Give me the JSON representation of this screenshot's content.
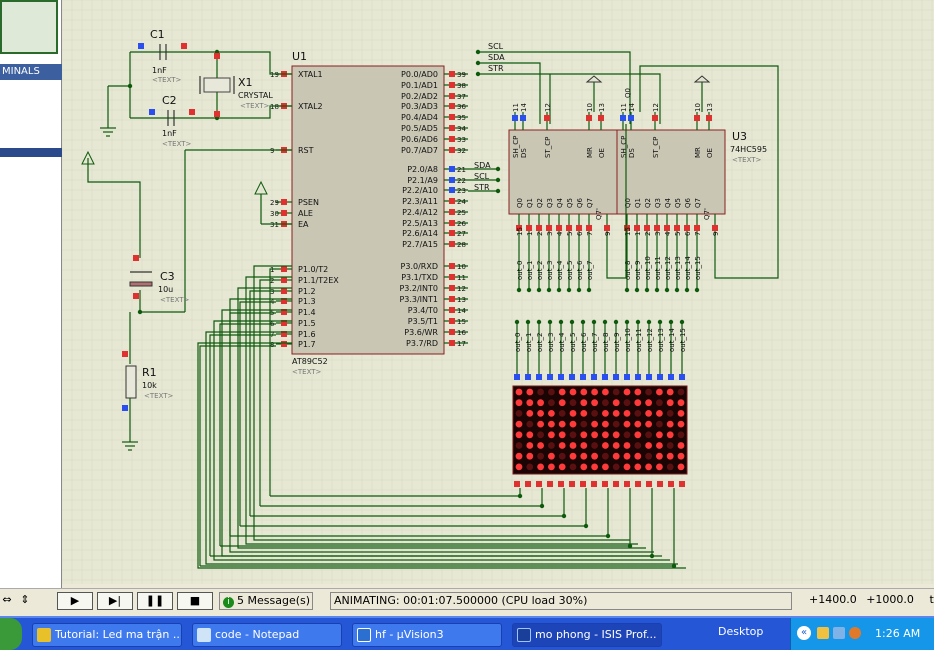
{
  "left_panel": {
    "terminals_label": "MINALS"
  },
  "schematic": {
    "u1": {
      "ref": "U1",
      "part": "AT89C52",
      "text": "<TEXT>",
      "left_pins": [
        {
          "num": "19",
          "name": "XTAL1"
        },
        {
          "num": "18",
          "name": "XTAL2"
        },
        {
          "num": "9",
          "name": "RST"
        },
        {
          "num": "29",
          "name": "PSEN"
        },
        {
          "num": "30",
          "name": "ALE"
        },
        {
          "num": "31",
          "name": "EA"
        },
        {
          "num": "1",
          "name": "P1.0/T2"
        },
        {
          "num": "2",
          "name": "P1.1/T2EX"
        },
        {
          "num": "3",
          "name": "P1.2"
        },
        {
          "num": "4",
          "name": "P1.3"
        },
        {
          "num": "5",
          "name": "P1.4"
        },
        {
          "num": "6",
          "name": "P1.5"
        },
        {
          "num": "7",
          "name": "P1.6"
        },
        {
          "num": "8",
          "name": "P1.7"
        }
      ],
      "right_pins": [
        {
          "num": "39",
          "name": "P0.0/AD0"
        },
        {
          "num": "38",
          "name": "P0.1/AD1"
        },
        {
          "num": "37",
          "name": "P0.2/AD2"
        },
        {
          "num": "36",
          "name": "P0.3/AD3"
        },
        {
          "num": "35",
          "name": "P0.4/AD4"
        },
        {
          "num": "34",
          "name": "P0.5/AD5"
        },
        {
          "num": "33",
          "name": "P0.6/AD6"
        },
        {
          "num": "32",
          "name": "P0.7/AD7"
        },
        {
          "num": "21",
          "name": "P2.0/A8"
        },
        {
          "num": "22",
          "name": "P2.1/A9"
        },
        {
          "num": "23",
          "name": "P2.2/A10"
        },
        {
          "num": "24",
          "name": "P2.3/A11"
        },
        {
          "num": "25",
          "name": "P2.4/A12"
        },
        {
          "num": "26",
          "name": "P2.5/A13"
        },
        {
          "num": "27",
          "name": "P2.6/A14"
        },
        {
          "num": "28",
          "name": "P2.7/A15"
        },
        {
          "num": "10",
          "name": "P3.0/RXD"
        },
        {
          "num": "11",
          "name": "P3.1/TXD"
        },
        {
          "num": "12",
          "name": "P3.2/INT0"
        },
        {
          "num": "13",
          "name": "P3.3/INT1"
        },
        {
          "num": "14",
          "name": "P3.4/T0"
        },
        {
          "num": "15",
          "name": "P3.5/T1"
        },
        {
          "num": "16",
          "name": "P3.6/WR"
        },
        {
          "num": "17",
          "name": "P3.7/RD"
        }
      ]
    },
    "p2_net_labels": [
      "SDA",
      "SCL",
      "STR"
    ],
    "top_net_labels": [
      "SCL",
      "SDA",
      "STR"
    ],
    "components": {
      "c1": {
        "ref": "C1",
        "value": "1nF",
        "text": "<TEXT>"
      },
      "c2": {
        "ref": "C2",
        "value": "1nF",
        "text": "<TEXT>"
      },
      "x1": {
        "ref": "X1",
        "value": "CRYSTAL",
        "text": "<TEXT>"
      },
      "c3": {
        "ref": "C3",
        "value": "10u",
        "text": "<TEXT>"
      },
      "r1": {
        "ref": "R1",
        "value": "10k",
        "text": "<TEXT>"
      }
    },
    "shift_registers": {
      "u3_ref": "U3",
      "u3_part": "74HC595",
      "text": "<TEXT>",
      "input_pins": [
        "SH_CP",
        "DS",
        "ST_CP",
        "MR",
        "OE"
      ],
      "input_nums": [
        "11",
        "14",
        "12",
        "10",
        "13"
      ],
      "q7s_label": "Q7'",
      "outputs": [
        "Q0",
        "Q1",
        "Q2",
        "Q3",
        "Q4",
        "Q5",
        "Q6",
        "Q7"
      ],
      "output_nums": [
        "15",
        "1",
        "2",
        "3",
        "4",
        "5",
        "6",
        "7"
      ],
      "q7s_num": "9"
    },
    "out_labels": [
      "out_0",
      "out_1",
      "out_2",
      "out_3",
      "out_4",
      "out_5",
      "out_6",
      "out_7",
      "out_8",
      "out_9",
      "out_10",
      "out_11",
      "out_12",
      "out_13",
      "out_14",
      "out_15"
    ],
    "led_matrix": {
      "rows": 8,
      "cols": 16,
      "lit": [
        [
          1,
          1,
          0,
          0,
          1,
          1,
          1,
          1,
          1,
          0,
          1,
          1,
          0,
          1,
          1,
          0
        ],
        [
          1,
          1,
          1,
          0,
          1,
          0,
          1,
          1,
          0,
          1,
          0,
          1,
          1,
          0,
          1,
          1
        ],
        [
          0,
          1,
          1,
          1,
          0,
          1,
          1,
          0,
          1,
          1,
          1,
          0,
          1,
          1,
          0,
          1
        ],
        [
          1,
          0,
          1,
          1,
          1,
          1,
          0,
          1,
          1,
          0,
          1,
          1,
          1,
          0,
          1,
          1
        ],
        [
          1,
          1,
          0,
          1,
          1,
          0,
          1,
          1,
          1,
          1,
          0,
          1,
          0,
          1,
          1,
          0
        ],
        [
          0,
          1,
          1,
          0,
          1,
          1,
          1,
          0,
          1,
          1,
          1,
          0,
          1,
          1,
          0,
          1
        ],
        [
          1,
          1,
          0,
          1,
          0,
          1,
          1,
          1,
          0,
          1,
          1,
          1,
          0,
          1,
          1,
          1
        ],
        [
          1,
          0,
          1,
          1,
          1,
          0,
          1,
          1,
          1,
          0,
          1,
          1,
          1,
          1,
          0,
          1
        ]
      ],
      "lit_color": "#ff3a3a",
      "dim_color": "#5a1010",
      "body_color": "#1a0404"
    },
    "colors": {
      "background": "#e6e8d4",
      "wire": "#0d5a0d",
      "chip_fill": "#c9c6b4",
      "chip_border": "#8b2020",
      "pin_red": "#e03030",
      "pin_blue": "#2a4ef0"
    }
  },
  "statusbar": {
    "messages": "5 Message(s)",
    "status": "ANIMATING: 00:01:07.500000 (CPU load 30%)",
    "coord_x": "+1400.0",
    "coord_y": "+1000.0",
    "units": "th"
  },
  "taskbar": {
    "tasks": [
      {
        "label": "Tutorial: Led ma trận ...",
        "icon": "chrome-icon"
      },
      {
        "label": "code - Notepad",
        "icon": "notepad-icon"
      },
      {
        "label": "hf - µVision3",
        "icon": "uvision-icon"
      },
      {
        "label": "mo phong - ISIS Prof...",
        "icon": "isis-icon"
      }
    ],
    "desktop_label": "Desktop",
    "clock": "1:26 AM"
  }
}
